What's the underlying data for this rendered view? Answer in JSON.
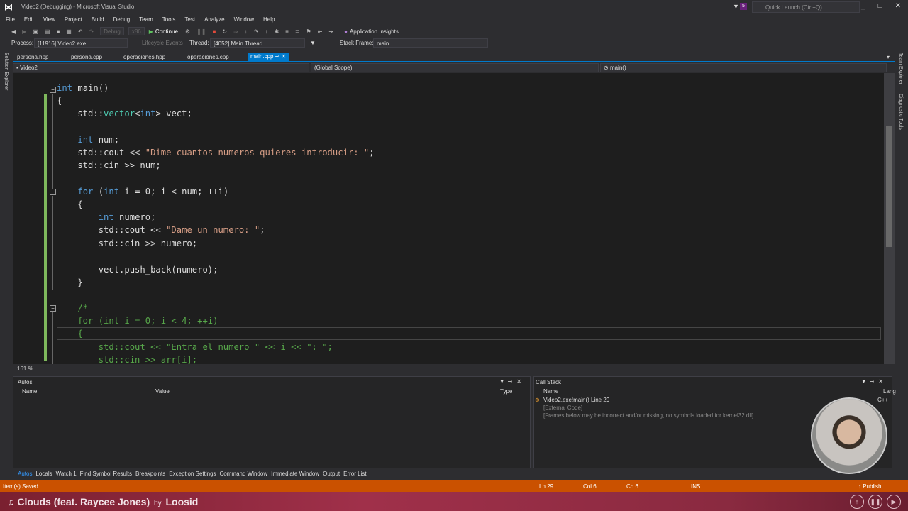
{
  "window": {
    "title": "Video2 (Debugging) - Microsoft Visual Studio",
    "notification_count": "5",
    "quick_launch_placeholder": "Quick Launch (Ctrl+Q)",
    "controls": [
      "_",
      "□",
      "✕"
    ]
  },
  "menu": [
    "File",
    "Edit",
    "View",
    "Project",
    "Build",
    "Debug",
    "Team",
    "Tools",
    "Test",
    "Analyze",
    "Window",
    "Help"
  ],
  "toolbar": {
    "config": "Debug",
    "platform": "x86",
    "continue_label": "Continue",
    "app_insights_label": "Application Insights"
  },
  "debug_location": {
    "process_label": "Process:",
    "process_value": "[11916] Video2.exe",
    "lifecycle_label": "Lifecycle Events",
    "thread_label": "Thread:",
    "thread_value": "[4052] Main Thread",
    "stackframe_label": "Stack Frame:",
    "stackframe_value": "main"
  },
  "side_tabs": {
    "left": "Solution Explorer",
    "right1": "Team Explorer",
    "right2": "Diagnostic Tools"
  },
  "tabs": [
    {
      "label": "persona.hpp"
    },
    {
      "label": "persona.cpp"
    },
    {
      "label": "operaciones.hpp"
    },
    {
      "label": "operaciones.cpp"
    },
    {
      "label": "main.cpp"
    }
  ],
  "nav": {
    "project": "Video2",
    "scope": "(Global Scope)",
    "member": "main()"
  },
  "editor": {
    "zoom": "161 %",
    "lines": {
      "l1_kw": "int",
      "l1_rest": " main()",
      "l2": "{",
      "l3_a": "    std::",
      "l3_b": "vector",
      "l3_c": "<",
      "l3_d": "int",
      "l3_e": "> vect;",
      "l5_kw": "int",
      "l5_rest": " num;",
      "l6_a": "    std::cout << ",
      "l6_str": "\"Dime cuantos numeros quieres introducir: \"",
      "l6_end": ";",
      "l7": "    std::cin >> num;",
      "l9_kw1": "for",
      "l9_a": " (",
      "l9_kw2": "int",
      "l9_b": " i = 0; i < num; ++i)",
      "l10": "    {",
      "l11_kw": "int",
      "l11_rest": " numero;",
      "l12_a": "        std::cout << ",
      "l12_str": "\"Dame un numero: \"",
      "l12_end": ";",
      "l13": "        std::cin >> numero;",
      "l15": "        vect.push_back(numero);",
      "l16": "    }",
      "l18": "    /*",
      "l19": "    for (int i = 0; i < 4; ++i)",
      "l20": "    {",
      "l21": "        std::cout << \"Entra el numero \" << i << \": \";",
      "l22": "        std::cin >> arr[i];"
    }
  },
  "autos": {
    "title": "Autos",
    "columns": [
      "Name",
      "Value",
      "Type"
    ]
  },
  "callstack": {
    "title": "Call Stack",
    "columns": [
      "Name",
      "Lang"
    ],
    "rows": [
      {
        "name": "Video2.exe!main() Line 29",
        "lang": "C++"
      },
      {
        "name": "[External Code]",
        "lang": ""
      },
      {
        "name": "[Frames below may be incorrect and/or missing, no symbols loaded for kernel32.dll]",
        "lang": ""
      }
    ]
  },
  "bottom_tabs": [
    "Autos",
    "Locals",
    "Watch 1",
    "Find Symbol Results",
    "Breakpoints",
    "Exception Settings",
    "Command Window",
    "Immediate Window",
    "Output",
    "Error List"
  ],
  "status": {
    "message": "Item(s) Saved",
    "ln": "Ln 29",
    "col": "Col 6",
    "ch": "Ch 6",
    "mode": "INS",
    "publish": "Publish"
  },
  "music": {
    "song": "Clouds (feat. Raycee Jones)",
    "by": "by",
    "artist": "Loosid"
  },
  "colors": {
    "accent": "#007acc",
    "status_bar": "#ca5100",
    "keyword": "#569cd6",
    "string": "#d69d85",
    "comment": "#57a64a"
  }
}
